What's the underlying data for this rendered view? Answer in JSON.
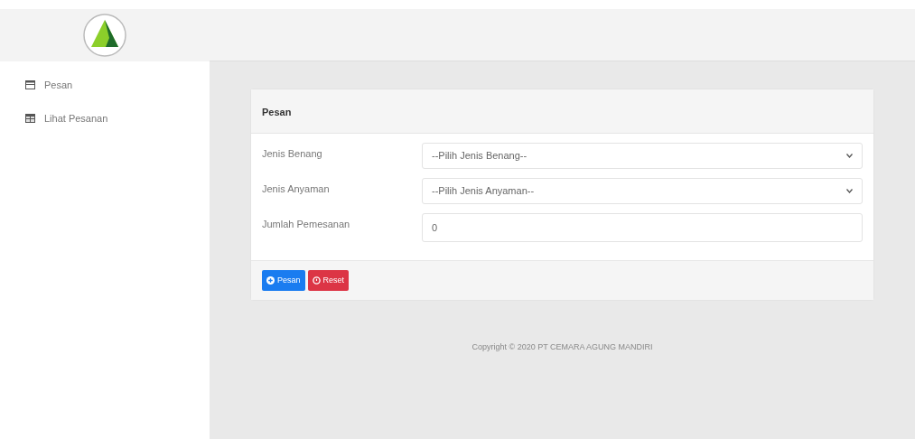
{
  "sidebar": {
    "items": [
      {
        "label": "Pesan",
        "kind": "list"
      },
      {
        "label": "Lihat Pesanan",
        "kind": "table"
      }
    ]
  },
  "card": {
    "title": "Pesan",
    "fields": [
      {
        "kind": "select",
        "label": "Jenis Benang",
        "value": "--Pilih Jenis Benang--"
      },
      {
        "kind": "select",
        "label": "Jenis Anyaman",
        "value": "--Pilih Jenis Anyaman--"
      },
      {
        "kind": "input",
        "label": "Jumlah Pemesanan",
        "value": "0"
      }
    ],
    "buttons": [
      {
        "label": "Pesan",
        "kind": "primary"
      },
      {
        "label": "Reset",
        "kind": "danger"
      }
    ]
  },
  "footer": "Copyright © 2020 PT CEMARA AGUNG MANDIRI"
}
